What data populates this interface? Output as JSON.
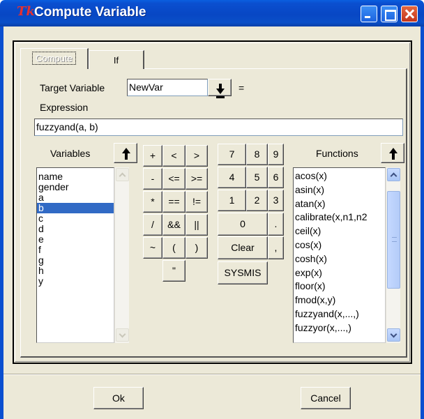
{
  "window": {
    "logo": "Tk",
    "title": "Compute Variable"
  },
  "tabs": [
    {
      "label": "Compute"
    },
    {
      "label": "If"
    }
  ],
  "target": {
    "label": "Target Variable",
    "value": "NewVar",
    "equals": "="
  },
  "expression": {
    "label": "Expression",
    "value": "fuzzyand(a, b)"
  },
  "variables": {
    "header": "Variables",
    "items": [
      "name",
      "gender",
      "a",
      "b",
      "c",
      "d",
      "e",
      "f",
      "g",
      "h",
      "y"
    ],
    "selected": "b"
  },
  "operators": {
    "rows": [
      [
        "+",
        "<",
        ">"
      ],
      [
        "-",
        "<=",
        ">="
      ],
      [
        "*",
        "==",
        "!="
      ],
      [
        "/",
        "&&",
        "||"
      ],
      [
        "~",
        "(",
        ")"
      ],
      [
        "\""
      ]
    ]
  },
  "keypad": {
    "rows": [
      [
        "7",
        "8",
        "9"
      ],
      [
        "4",
        "5",
        "6"
      ],
      [
        "1",
        "2",
        "3"
      ]
    ],
    "zero": "0",
    "dot": ".",
    "clear": "Clear",
    "comma": ",",
    "sysmis": "SYSMIS"
  },
  "functions": {
    "header": "Functions",
    "items": [
      "acos(x)",
      "asin(x)",
      "atan(x)",
      "calibrate(x,n1,n2",
      "ceil(x)",
      "cos(x)",
      "cosh(x)",
      "exp(x)",
      "floor(x)",
      "fmod(x,y)",
      "fuzzyand(x,...,)",
      "fuzzyor(x,...,)"
    ]
  },
  "buttons": {
    "ok": "Ok",
    "cancel": "Cancel"
  },
  "colors": {
    "titlebar": "#0a4fd0",
    "selection": "#316ac5",
    "dialog": "#ece9d8"
  }
}
